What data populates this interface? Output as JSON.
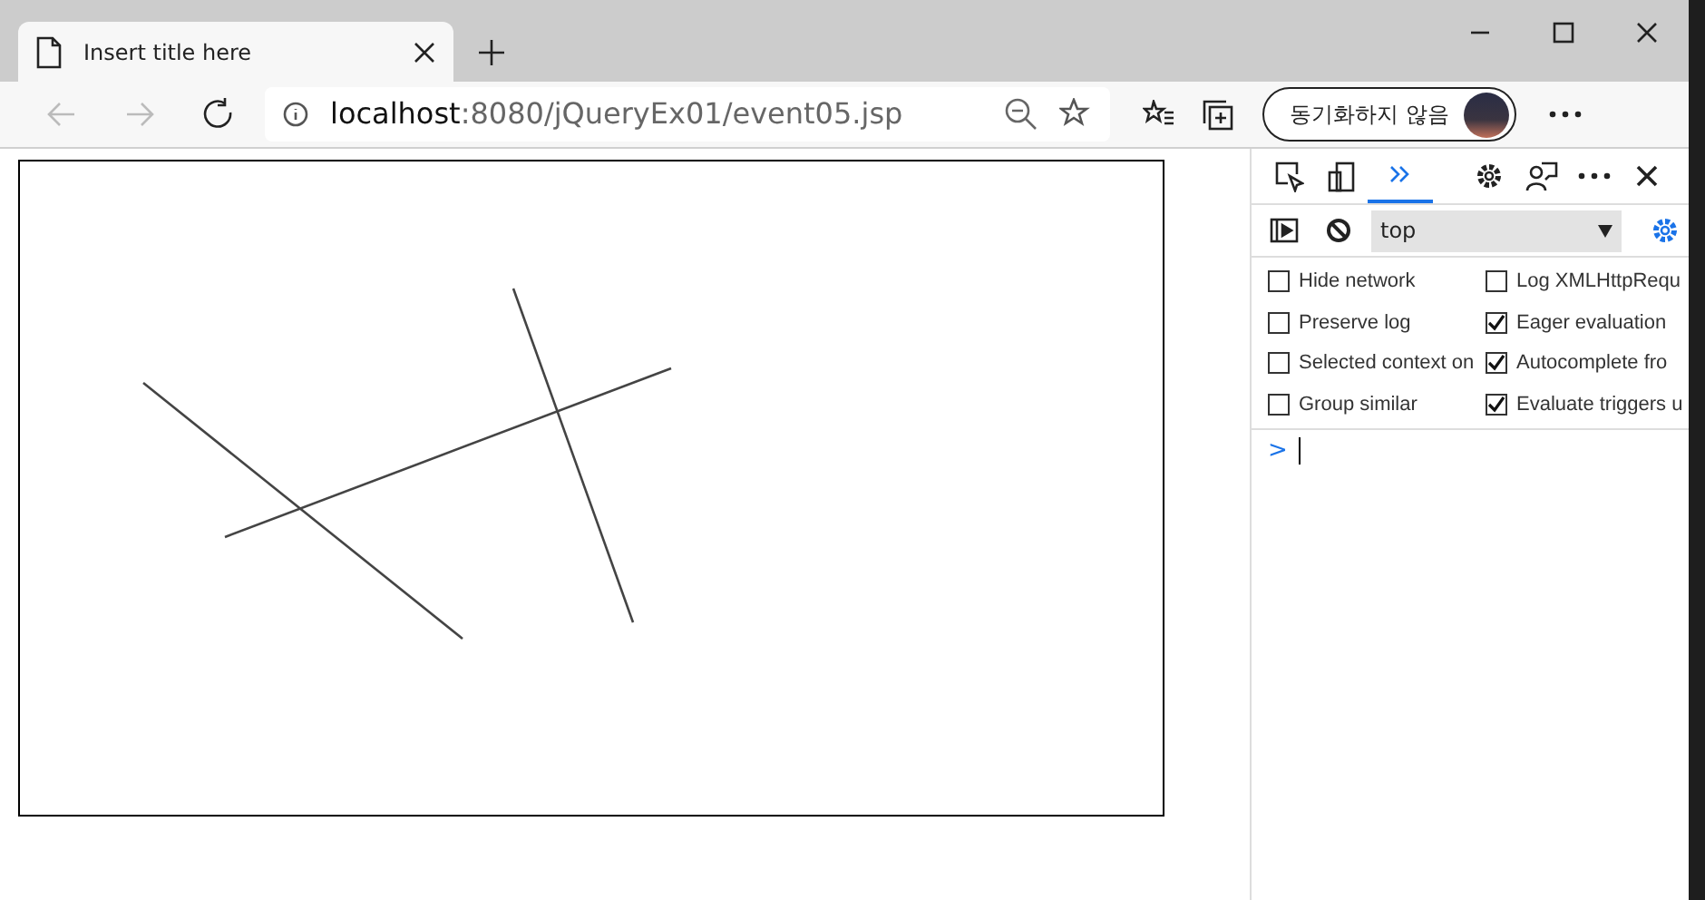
{
  "tab": {
    "title": "Insert title here",
    "selected": true
  },
  "address_bar": {
    "host": "localhost",
    "path": ":8080/jQueryEx01/event05.jsp"
  },
  "profile_button": {
    "label": "동기화하지 않음"
  },
  "devtools": {
    "panel_tabs": [
      {
        "kind": "inspect",
        "selected": false
      },
      {
        "kind": "device",
        "selected": false
      },
      {
        "kind": "more",
        "selected": true
      }
    ],
    "context": {
      "value": "top"
    },
    "options": [
      {
        "label": "Hide network",
        "checked": false
      },
      {
        "label": "Log XMLHttpRequ",
        "checked": false
      },
      {
        "label": "Preserve log",
        "checked": false
      },
      {
        "label": "Eager evaluation",
        "checked": true
      },
      {
        "label": "Selected context on",
        "checked": false
      },
      {
        "label": "Autocomplete fro",
        "checked": true
      },
      {
        "label": "Group similar",
        "checked": false
      },
      {
        "label": "Evaluate triggers u",
        "checked": true
      }
    ],
    "prompt": ">"
  }
}
